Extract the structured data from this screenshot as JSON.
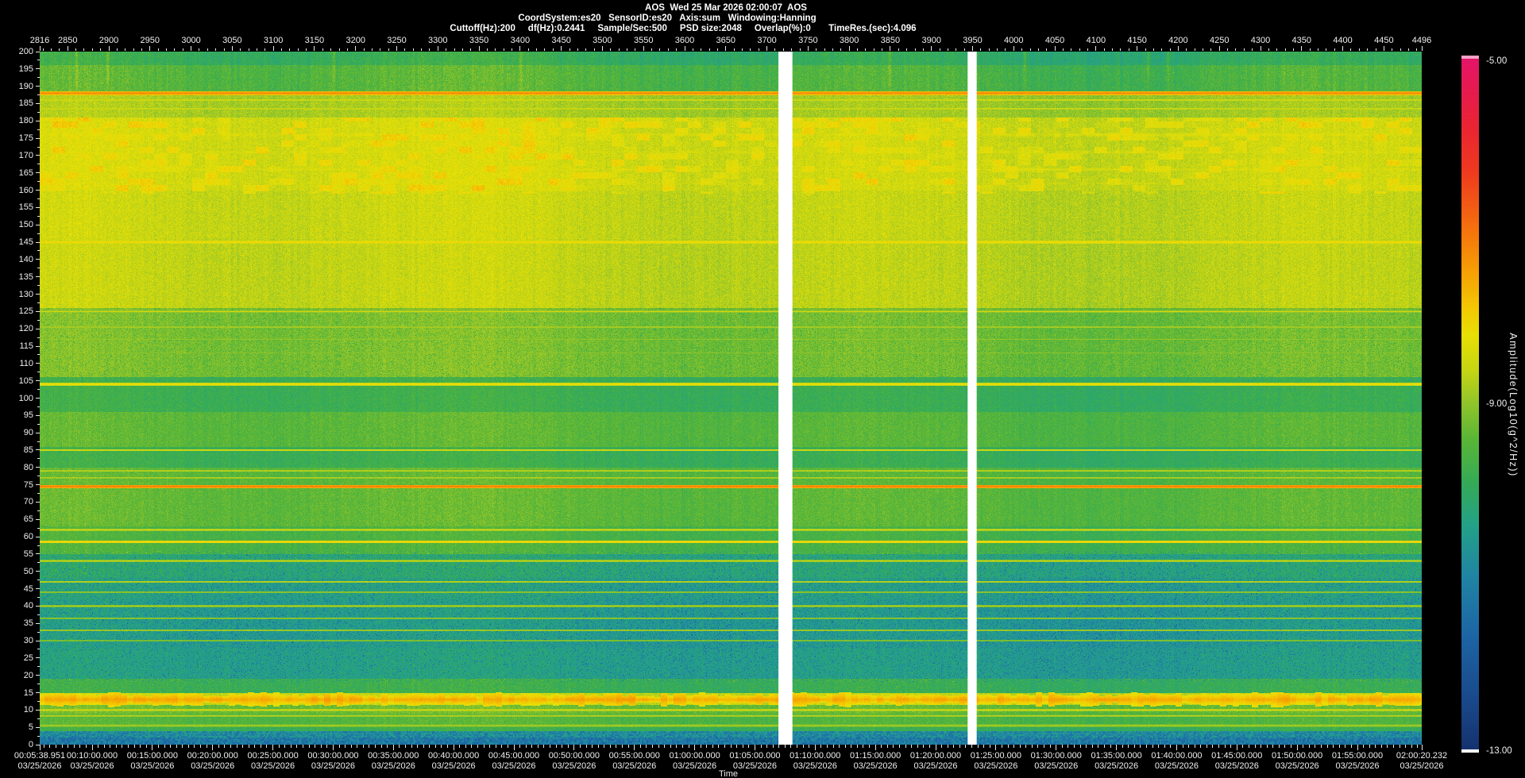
{
  "window": {
    "background": "#000000"
  },
  "header": {
    "title": "AOS  Wed 25 Mar 2026 02:00:07  AOS",
    "line2": "CoordSystem:es20   SensorID:es20   Axis:sum   Windowing:Hanning",
    "line3": "Cuttoff(Hz):200     df(Hz):0.2441     Sample/Sec:500     PSD size:2048     Overlap(%):0       TimeRes.(sec):4.096"
  },
  "chart_data": {
    "type": "heatmap",
    "subtype": "spectrogram",
    "title": "AOS  Wed 25 Mar 2026 02:00:07  AOS",
    "x_top_axis": {
      "unit": "record",
      "min": 2816,
      "max": 4496,
      "minor_step": 10,
      "ticks": [
        2816,
        2850,
        2900,
        2950,
        3000,
        3050,
        3100,
        3150,
        3200,
        3250,
        3300,
        3350,
        3400,
        3450,
        3500,
        3550,
        3600,
        3650,
        3700,
        3750,
        3800,
        3850,
        3900,
        3950,
        4000,
        4050,
        4100,
        4150,
        4200,
        4250,
        4300,
        4350,
        4400,
        4450,
        4496
      ]
    },
    "y_axis": {
      "unit": "Hz",
      "min": 0,
      "max": 200,
      "minor_step": 2.5,
      "ticks": [
        200,
        195,
        190,
        185,
        180,
        175,
        170,
        165,
        160,
        155,
        150,
        145,
        140,
        135,
        130,
        125,
        120,
        115,
        110,
        105,
        100,
        95,
        90,
        85,
        80,
        75,
        70,
        65,
        60,
        55,
        50,
        45,
        40,
        35,
        30,
        25,
        20,
        15,
        10,
        5,
        0
      ]
    },
    "x_bottom_axis": {
      "title": "Time",
      "date": "03/25/2026",
      "minor_step_seconds": 30,
      "labels": [
        "00:05:38.951",
        "00:10:00.000",
        "00:15:00.000",
        "00:20:00.000",
        "00:25:00.000",
        "00:30:00.000",
        "00:35:00.000",
        "00:40:00.000",
        "00:45:00.000",
        "00:50:00.000",
        "00:55:00.000",
        "01:00:00.000",
        "01:05:00.000",
        "01:10:00.000",
        "01:15:00.000",
        "01:20:00.000",
        "01:25:00.000",
        "01:30:00.000",
        "01:35:00.000",
        "01:40:00.000",
        "01:45:00.000",
        "01:50:00.000",
        "01:55:00.000",
        "02:00:20.232"
      ]
    },
    "colorbar": {
      "label": "Amplitude(Log10(g^2/Hz))",
      "tick_labels": [
        "-5.00",
        "-9.00",
        "-13.00"
      ],
      "tick_values": [
        -5,
        -9,
        -13
      ],
      "over_color": "#f5a0c8",
      "under_color": "#ffffff",
      "colormap": [
        [
          -13.0,
          "#16326f"
        ],
        [
          -12.4,
          "#1a4a8c"
        ],
        [
          -11.7,
          "#1d64a4"
        ],
        [
          -11.0,
          "#2084a4"
        ],
        [
          -10.4,
          "#24a188"
        ],
        [
          -9.9,
          "#35ab57"
        ],
        [
          -9.4,
          "#5ab636"
        ],
        [
          -9.0,
          "#8fc42c"
        ],
        [
          -8.6,
          "#c6d513"
        ],
        [
          -8.2,
          "#e8e006"
        ],
        [
          -7.9,
          "#f3ca04"
        ],
        [
          -7.5,
          "#f6a304"
        ],
        [
          -7.1,
          "#f67e0b"
        ],
        [
          -6.7,
          "#f35a15"
        ],
        [
          -6.3,
          "#ef3a1f"
        ],
        [
          -5.8,
          "#ea2532"
        ],
        [
          -5.4,
          "#e71c4d"
        ],
        [
          -5.0,
          "#e51569"
        ]
      ]
    },
    "data_gaps_records": [
      [
        3714,
        3731
      ],
      [
        3944,
        3955
      ]
    ],
    "background_bands": [
      {
        "f_lo": 196,
        "f_hi": 200.5,
        "level": -9.95
      },
      {
        "f_lo": 188,
        "f_hi": 196,
        "level": -9.55
      },
      {
        "f_lo": 181,
        "f_hi": 188,
        "level": -8.85
      },
      {
        "f_lo": 160,
        "f_hi": 181,
        "level": -8.5
      },
      {
        "f_lo": 146,
        "f_hi": 160,
        "level": -8.6
      },
      {
        "f_lo": 126,
        "f_hi": 146,
        "level": -8.65
      },
      {
        "f_lo": 106,
        "f_hi": 126,
        "level": -9.2
      },
      {
        "f_lo": 96,
        "f_hi": 106,
        "level": -9.85
      },
      {
        "f_lo": 86,
        "f_hi": 96,
        "level": -9.45
      },
      {
        "f_lo": 80,
        "f_hi": 86,
        "level": -9.85
      },
      {
        "f_lo": 75,
        "f_hi": 80,
        "level": -9.45
      },
      {
        "f_lo": 63,
        "f_hi": 75,
        "level": -9.4
      },
      {
        "f_lo": 55,
        "f_hi": 63,
        "level": -9.65
      },
      {
        "f_lo": 48,
        "f_hi": 55,
        "level": -10.25
      },
      {
        "f_lo": 42,
        "f_hi": 48,
        "level": -10.45
      },
      {
        "f_lo": 28,
        "f_hi": 42,
        "level": -10.55
      },
      {
        "f_lo": 19,
        "f_hi": 28,
        "level": -10.45
      },
      {
        "f_lo": 15,
        "f_hi": 19,
        "level": -9.85
      },
      {
        "f_lo": 11.5,
        "f_hi": 15,
        "level": -8.6
      },
      {
        "f_lo": 9,
        "f_hi": 11.5,
        "level": -9.3
      },
      {
        "f_lo": 6,
        "f_hi": 9,
        "level": -9.55
      },
      {
        "f_lo": 4,
        "f_hi": 6,
        "level": -9.85
      },
      {
        "f_lo": 2,
        "f_hi": 4,
        "level": -10.9
      },
      {
        "f_lo": 0,
        "f_hi": 2,
        "level": -11.25
      }
    ],
    "tonal_lines": [
      {
        "f": 188,
        "level": -7.2,
        "hw": 0.5
      },
      {
        "f": 186,
        "level": -8.3,
        "hw": 0.28
      },
      {
        "f": 183.5,
        "level": -8.35,
        "hw": 0.3
      },
      {
        "f": 176,
        "level": -8.35,
        "hw": 0.9,
        "ragged": true
      },
      {
        "f": 171,
        "level": -8.45,
        "hw": 0.7,
        "ragged": true
      },
      {
        "f": 166,
        "level": -8.4,
        "hw": 0.7,
        "ragged": true
      },
      {
        "f": 162,
        "level": -8.5,
        "hw": 0.5,
        "ragged": true
      },
      {
        "f": 145,
        "level": -7.95,
        "hw": 0.45
      },
      {
        "f": 125,
        "level": -8.45,
        "hw": 0.28
      },
      {
        "f": 120.5,
        "level": -8.6,
        "hw": 0.26
      },
      {
        "f": 117,
        "level": -8.85,
        "hw": 0.22
      },
      {
        "f": 113,
        "level": -8.9,
        "hw": 0.2
      },
      {
        "f": 104,
        "level": -8.1,
        "hw": 0.45
      },
      {
        "f": 85,
        "level": -8.3,
        "hw": 0.3
      },
      {
        "f": 79,
        "level": -8.5,
        "hw": 0.26
      },
      {
        "f": 77,
        "level": -8.55,
        "hw": 0.24
      },
      {
        "f": 74.5,
        "level": -7.05,
        "hw": 0.45
      },
      {
        "f": 62,
        "level": -8.4,
        "hw": 0.3
      },
      {
        "f": 58.5,
        "level": -7.9,
        "hw": 0.4
      },
      {
        "f": 53,
        "level": -8.55,
        "hw": 0.3
      },
      {
        "f": 47,
        "level": -8.55,
        "hw": 0.3
      },
      {
        "f": 44,
        "level": -8.8,
        "hw": 0.26
      },
      {
        "f": 40,
        "level": -8.7,
        "hw": 0.3
      },
      {
        "f": 36.5,
        "level": -8.8,
        "hw": 0.26
      },
      {
        "f": 33,
        "level": -8.7,
        "hw": 0.3
      },
      {
        "f": 30,
        "level": -8.9,
        "hw": 0.26
      },
      {
        "f": 13,
        "level": -7.55,
        "hw": 1.4,
        "ragged": true
      },
      {
        "f": 10,
        "level": -8.45,
        "hw": 0.4
      },
      {
        "f": 8.3,
        "level": -8.6,
        "hw": 0.3
      },
      {
        "f": 5.5,
        "level": -8.7,
        "hw": 0.35
      }
    ],
    "vertical_streaks": [
      {
        "rec": 2860,
        "strength": 0.35
      },
      {
        "rec": 2898,
        "strength": 0.55
      },
      {
        "rec": 3173,
        "strength": 0.45
      },
      {
        "rec": 3400,
        "strength": 0.4
      },
      {
        "rec": 3849,
        "strength": 0.5
      },
      {
        "rec": 4013,
        "strength": 0.6
      },
      {
        "rec": 4163,
        "strength": 0.45
      },
      {
        "rec": 4187,
        "strength": 0.4
      }
    ],
    "noise": {
      "base_amp": 0.42,
      "teal_speckle_rate": 0.07,
      "bright_speckle_rate": 0.04
    }
  }
}
